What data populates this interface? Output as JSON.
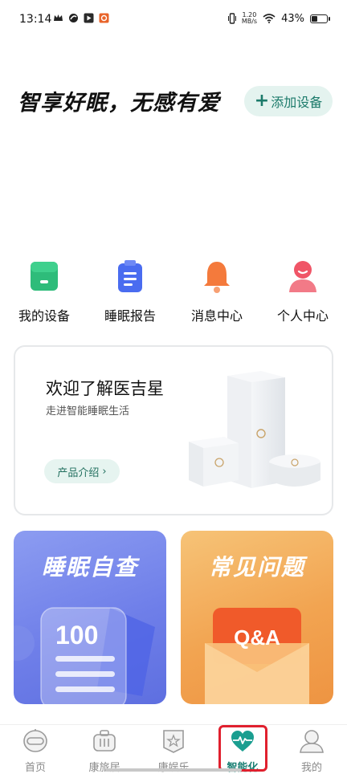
{
  "status_bar": {
    "time": "13:14",
    "net_speed_value": "1.20",
    "net_speed_unit": "MB/s",
    "battery_percent": "43%",
    "battery_level": 0.43
  },
  "header": {
    "headline": "智享好眠，无感有爱",
    "add_device_label": "添加设备"
  },
  "quick_entries": [
    {
      "label": "我的设备",
      "icon": "device-box-icon",
      "color": "#2ebc7a"
    },
    {
      "label": "睡眠报告",
      "icon": "report-clipboard-icon",
      "color": "#4a6cf0"
    },
    {
      "label": "消息中心",
      "icon": "bell-icon",
      "color": "#f47a3c"
    },
    {
      "label": "个人中心",
      "icon": "person-icon",
      "color": "#f05567"
    }
  ],
  "product_card": {
    "title": "欢迎了解医吉星",
    "subtitle": "走进智能睡眠生活",
    "button_label": "产品介绍"
  },
  "tiles": {
    "sleep_check": {
      "title": "睡眠自查",
      "score": "100"
    },
    "faq": {
      "title": "常见问题",
      "badge": "Q&A"
    }
  },
  "bottom_nav": {
    "items": [
      {
        "label": "首页",
        "icon": "robot-face-icon",
        "active": false
      },
      {
        "label": "康旅居",
        "icon": "suitcase-icon",
        "active": false
      },
      {
        "label": "康娱乐",
        "icon": "star-badge-icon",
        "active": false
      },
      {
        "label": "智能化",
        "icon": "heart-pulse-icon",
        "active": true
      },
      {
        "label": "我的",
        "icon": "user-icon",
        "active": false
      }
    ]
  },
  "colors": {
    "accent": "#1a7f73",
    "highlight_border": "#e0202e"
  }
}
